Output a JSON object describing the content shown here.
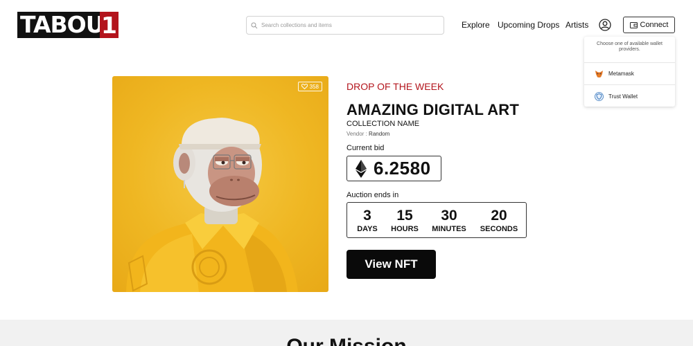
{
  "header": {
    "logo_text": "TABOU",
    "logo_mark": "1",
    "search_placeholder": "Search collections and items",
    "nav": {
      "explore": "Explore",
      "upcoming": "Upcoming Drops",
      "artists": "Artists"
    },
    "connect_label": "Connect"
  },
  "wallet_menu": {
    "note": "Choose one of available wallet providers.",
    "items": [
      {
        "label": "Metamask",
        "icon": "metamask-fox-icon"
      },
      {
        "label": "Trust Wallet",
        "icon": "trust-wallet-shield-icon"
      }
    ]
  },
  "artwork": {
    "likes": "358",
    "subject": "ape-in-yellow-jacket"
  },
  "drop": {
    "label": "DROP OF THE WEEK",
    "title": "AMAZING DIGITAL ART",
    "collection": "COLLECTION NAME",
    "vendor_key": "Vendor :",
    "vendor_value": "Random",
    "bid_label": "Current bid",
    "bid_value": "6.2580",
    "auction_label": "Auction ends in",
    "countdown": [
      {
        "value": "3",
        "unit": "DAYS"
      },
      {
        "value": "15",
        "unit": "HOURS"
      },
      {
        "value": "30",
        "unit": "MINUTES"
      },
      {
        "value": "20",
        "unit": "SECONDS"
      }
    ],
    "cta": "View NFT"
  },
  "mission": {
    "title": "Our Mission"
  },
  "colors": {
    "accent": "#b3141c",
    "art_bg": "#efb723",
    "dark": "#0a0a0a"
  }
}
